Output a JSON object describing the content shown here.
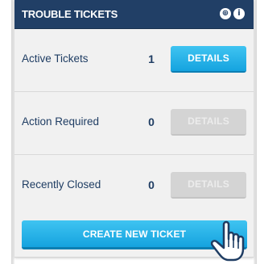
{
  "widget": {
    "title": "TROUBLE TICKETS",
    "header_icons": [
      "globe-icon",
      "info-icon"
    ]
  },
  "rows": [
    {
      "label": "Active Tickets",
      "count": "1",
      "button_label": "DETAILS",
      "button_state": "active"
    },
    {
      "label": "Action Required",
      "count": "0",
      "button_label": "DETAILS",
      "button_state": "disabled"
    },
    {
      "label": "Recently Closed",
      "count": "0",
      "button_label": "DETAILS",
      "button_state": "disabled"
    }
  ],
  "create_button": {
    "label": "CREATE NEW TICKET"
  },
  "colors": {
    "header_bg": "#213f66",
    "accent": "#15a3df",
    "disabled": "#d4d4d4",
    "text": "#1f3d63"
  }
}
